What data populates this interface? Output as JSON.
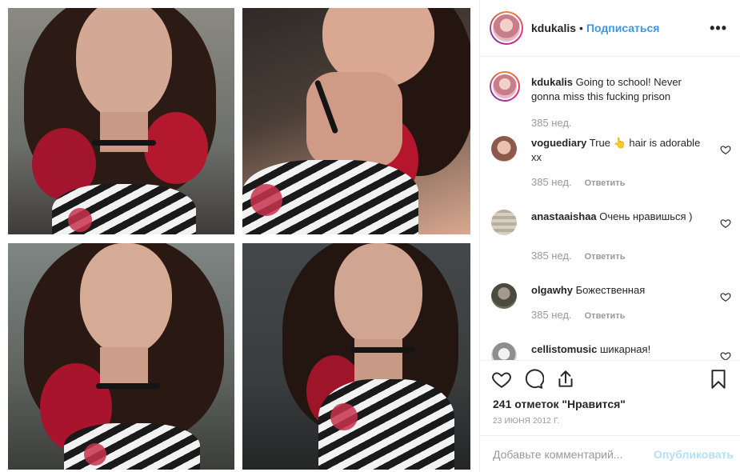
{
  "header": {
    "username": "kdukalis",
    "separator": "•",
    "follow_label": "Подписаться",
    "more_label": "•••"
  },
  "caption": {
    "username": "kdukalis",
    "text": "Going to school! Never gonna miss this fucking prison",
    "time": "385 нед."
  },
  "comments": [
    {
      "username": "voguediary",
      "text": "True 👆 hair is adorable xx",
      "time": "385 нед.",
      "reply_label": "Ответить"
    },
    {
      "username": "anastaaishaa",
      "text": "Очень нравишься )",
      "time": "385 нед.",
      "reply_label": "Ответить"
    },
    {
      "username": "olgawhy",
      "text": "Божественная",
      "time": "385 нед.",
      "reply_label": "Ответить"
    },
    {
      "username": "cellistomusic",
      "text": "шикарная!"
    }
  ],
  "actions": {
    "likes_text": "241 отметок \"Нравится\"",
    "date_text": "23 ИЮНЯ 2012 Г."
  },
  "add_comment": {
    "placeholder": "Добавьте комментарий...",
    "publish_label": "Опубликовать"
  },
  "icons": [
    "like-icon",
    "comment-icon",
    "share-icon",
    "bookmark-icon",
    "more-icon",
    "small-heart-icon"
  ],
  "colors": {
    "accent": "#3897f0",
    "muted": "#999999",
    "publish_disabled": "#b2dffc",
    "border": "#efefef"
  }
}
